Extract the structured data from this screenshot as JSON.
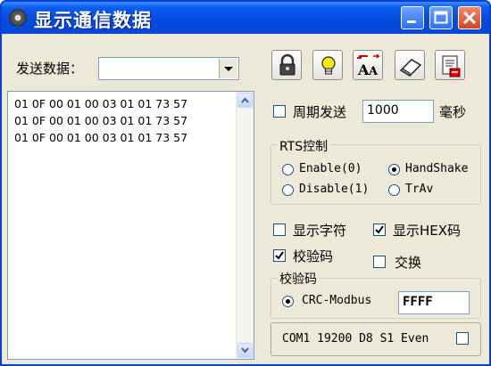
{
  "window": {
    "title": "显示通信数据"
  },
  "send": {
    "label": "发送数据：",
    "value": ""
  },
  "toolbar": {
    "buttons": [
      {
        "name": "lock-button",
        "icon": "lock-icon"
      },
      {
        "name": "bulb-button",
        "icon": "lightbulb-icon"
      },
      {
        "name": "font-button",
        "icon": "font-aa-icon"
      },
      {
        "name": "clear-button",
        "icon": "eraser-icon"
      },
      {
        "name": "save-button",
        "icon": "save-icon"
      }
    ]
  },
  "receive": {
    "lines": [
      "01 0F 00 01 00 03 01 01 73 57",
      "01 0F 00 01 00 03 01 01 73 57",
      "01 0F 00 01 00 03 01 01 73 57"
    ]
  },
  "periodic": {
    "label": "周期发送",
    "checked": false,
    "value": "1000",
    "unit": "毫秒"
  },
  "rts": {
    "title": "RTS控制",
    "enable": "Enable(0)",
    "handshake": "HandShake",
    "disable": "Disable(1)",
    "trav": "TrAv",
    "selected": "HandShake"
  },
  "display": {
    "show_chars": {
      "label": "显示字符",
      "checked": false
    },
    "show_hex": {
      "label": "显示HEX码",
      "checked": true
    },
    "checksum": {
      "label": "校验码",
      "checked": true
    },
    "swap": {
      "label": "交换",
      "checked": false
    }
  },
  "checksum_group": {
    "title": "校验码",
    "option": "CRC-Modbus",
    "selected": true,
    "value": "FFFF"
  },
  "status": {
    "text": "COM1 19200 D8 S1 Even",
    "checked": false
  },
  "colors": {
    "titlebar": "#0549de",
    "window_bg": "#ece9d8",
    "border": "#0a3fd6"
  }
}
